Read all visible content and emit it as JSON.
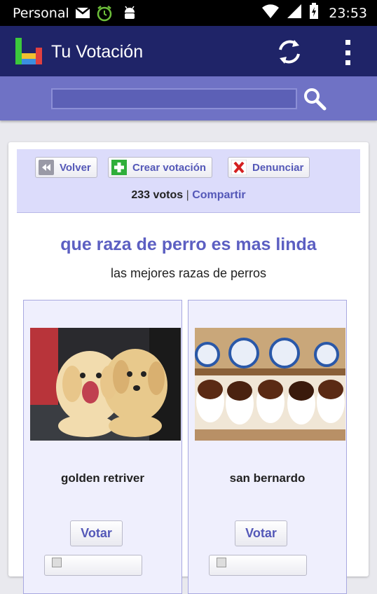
{
  "status_bar": {
    "carrier": "Personal",
    "time": "23:53",
    "icons": [
      "mail-icon",
      "alarm-icon",
      "android-debug-icon",
      "wifi-icon",
      "signal-icon",
      "battery-charging-icon"
    ]
  },
  "app_bar": {
    "title": "Tu Votación",
    "actions": [
      "refresh-icon",
      "overflow-menu-icon"
    ]
  },
  "search": {
    "value": "",
    "placeholder": ""
  },
  "toolbar": {
    "back_label": "Volver",
    "create_label": "Crear votación",
    "report_label": "Denunciar"
  },
  "stats": {
    "votes": "233 votos",
    "separator": "|",
    "share_label": "Compartir"
  },
  "poll": {
    "title": "que raza de perro es mas linda",
    "subtitle": "las mejores razas de perros",
    "options": [
      {
        "name": "golden retriver",
        "vote_label": "Votar",
        "image": "golden retriever puppies photo"
      },
      {
        "name": "san bernardo",
        "vote_label": "Votar",
        "image": "saint bernard puppies photo"
      }
    ]
  },
  "colors": {
    "app_bar": "#1f2468",
    "search_bar": "#6f72c5",
    "accent_text": "#5c5fc2",
    "panel_bg": "#dcdcfb"
  }
}
